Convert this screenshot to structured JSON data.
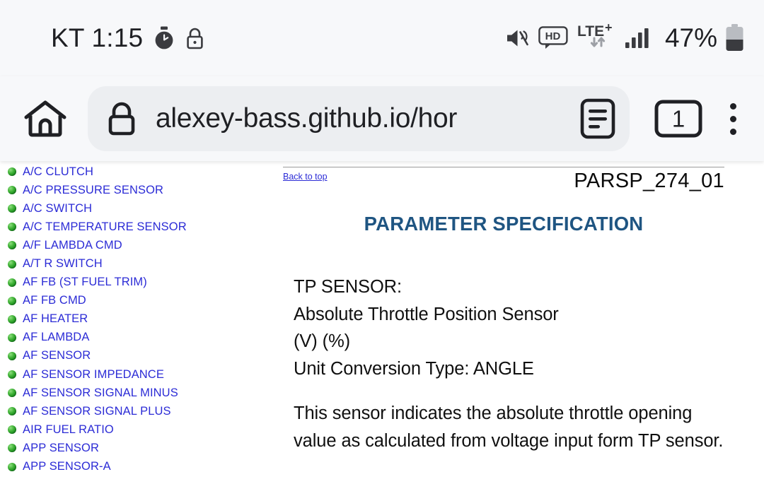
{
  "status_bar": {
    "carrier_time": "KT 1:15",
    "icons_left": [
      "stopwatch-icon",
      "lock-icon"
    ],
    "icons_right": [
      "mute-icon",
      "hd-icon",
      "lte-plus-icon",
      "signal-icon"
    ],
    "hd_label": "HD",
    "network_label": "LTE",
    "network_superscript": "+",
    "battery_percent": "47%"
  },
  "browser": {
    "home_icon": "home-icon",
    "lock_icon": "lock-icon",
    "url": "alexey-bass.github.io/hor",
    "reader_icon": "reader-mode-icon",
    "tab_count": "1",
    "menu_icon": "more-vertical-icon"
  },
  "sidebar": {
    "items": [
      {
        "label": "A/C CLUTCH"
      },
      {
        "label": "A/C PRESSURE SENSOR"
      },
      {
        "label": "A/C SWITCH"
      },
      {
        "label": "A/C TEMPERATURE SENSOR"
      },
      {
        "label": "A/F LAMBDA CMD"
      },
      {
        "label": "A/T R SWITCH"
      },
      {
        "label": "AF FB (ST FUEL TRIM)"
      },
      {
        "label": "AF FB CMD"
      },
      {
        "label": "AF HEATER"
      },
      {
        "label": "AF LAMBDA"
      },
      {
        "label": "AF SENSOR"
      },
      {
        "label": "AF SENSOR IMPEDANCE"
      },
      {
        "label": "AF SENSOR SIGNAL MINUS"
      },
      {
        "label": "AF SENSOR SIGNAL PLUS"
      },
      {
        "label": "AIR FUEL RATIO"
      },
      {
        "label": "APP SENSOR"
      },
      {
        "label": "APP SENSOR-A"
      }
    ]
  },
  "content": {
    "back_to_top": "Back to top",
    "doc_id": "PARSP_274_01",
    "title": "PARAMETER SPECIFICATION",
    "lines": [
      "TP SENSOR:",
      "Absolute Throttle Position Sensor",
      "(V) (%)",
      "Unit Conversion Type: ANGLE"
    ],
    "paragraph": "This sensor indicates the absolute throttle opening value as calculated from voltage input form TP sensor."
  },
  "colors": {
    "link_blue": "#2c2cd6",
    "heading_blue": "#1f5582",
    "bullet_green": "#13801a",
    "chrome_bg": "#f7f8fa",
    "pill_bg": "#eceef1"
  }
}
